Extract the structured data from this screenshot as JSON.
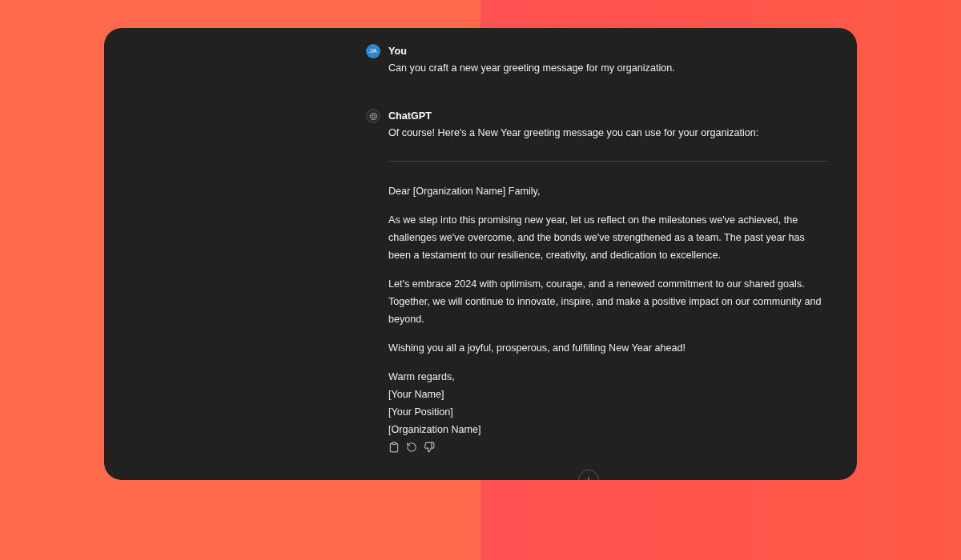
{
  "messages": [
    {
      "kind": "user",
      "avatar": "JA",
      "author": "You",
      "text": "Can you craft a new year greeting message for my organization."
    },
    {
      "kind": "assistant",
      "author": "ChatGPT",
      "text": "Of course! Here's a New Year greeting message you can use for your organization:",
      "paragraphs": [
        [
          "Dear [Organization Name] Family,"
        ],
        [
          "As we step into this promising new year, let us reflect on the milestones we've achieved, the challenges we've overcome, and the bonds we've strengthened as a team. The past year has been a testament to our resilience, creativity, and dedication to excellence."
        ],
        [
          "Let's embrace 2024 with optimism, courage, and a renewed commitment to our shared goals. Together, we will continue to innovate, inspire, and make a positive impact on our community and beyond."
        ],
        [
          "Wishing you all a joyful, prosperous, and fulfilling New Year ahead!"
        ],
        [
          "Warm regards,",
          "[Your Name]",
          "[Your Position]",
          "[Organization Name]"
        ]
      ],
      "actions": [
        {
          "kind": "copy"
        },
        {
          "kind": "regenerate"
        },
        {
          "kind": "dislike"
        }
      ]
    }
  ]
}
